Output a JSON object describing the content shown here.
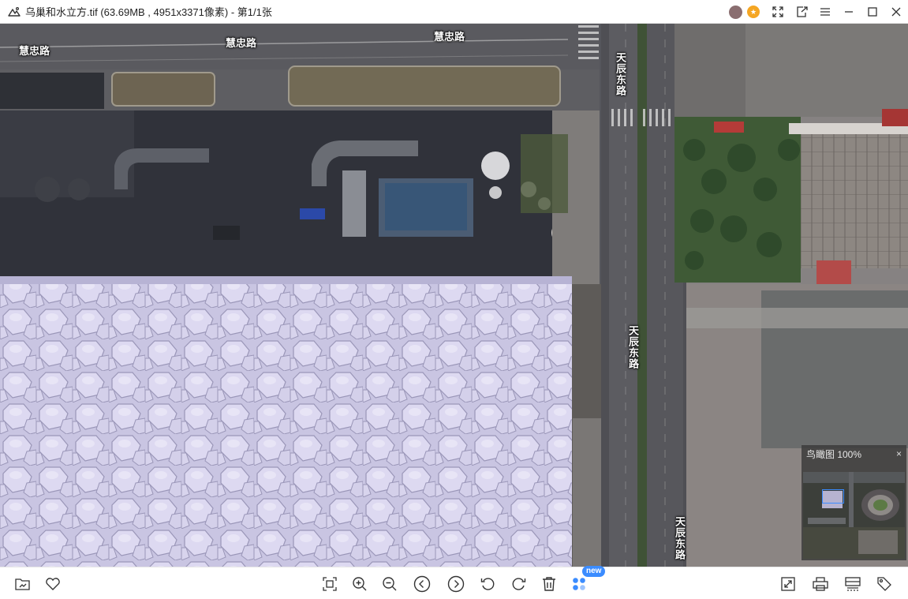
{
  "window": {
    "title": "乌巢和水立方.tif (63.69MB , 4951x3371像素) - 第1/1张",
    "app_icon": "image-viewer-icon",
    "controls": [
      "share-icon",
      "fullscreen-icon",
      "open-with-icon",
      "menu-icon",
      "minimize-icon",
      "maximize-icon",
      "close-icon"
    ]
  },
  "map": {
    "labels": {
      "huizhong_1": "慧忠路",
      "huizhong_2": "慧忠路",
      "huizhong_3": "慧忠路",
      "tianchen_1": "天辰东路",
      "tianchen_2": "天辰东路",
      "tianchen_3": "天辰东路"
    },
    "colors": {
      "cube_roof": "#cfcbe6",
      "road": "#4a4a4f",
      "shadow": "#2e2f36",
      "plaza": "#8c8888"
    }
  },
  "overview": {
    "title": "鸟瞰图 100%",
    "close": "×"
  },
  "toolbar": {
    "new_badge": "new",
    "left": [
      "open-folder-icon",
      "favorite-heart-icon"
    ],
    "center": [
      "fit-screen-icon",
      "zoom-in-icon",
      "zoom-out-icon",
      "previous-icon",
      "next-icon",
      "rotate-left-icon",
      "rotate-right-icon",
      "delete-icon",
      "more-apps-icon"
    ],
    "right": [
      "actual-size-icon",
      "print-icon",
      "scan-icon",
      "tag-icon"
    ]
  }
}
